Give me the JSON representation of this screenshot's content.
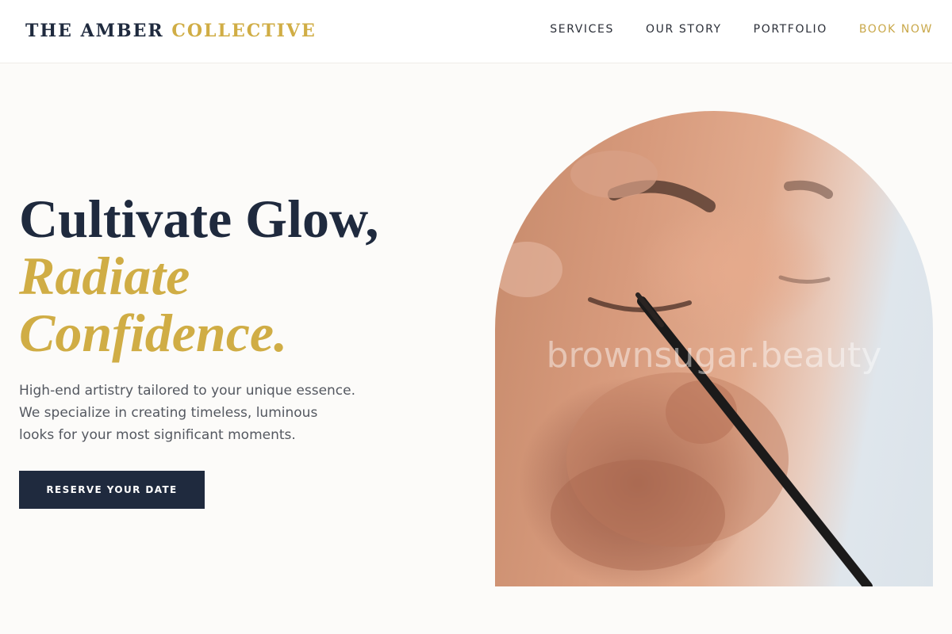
{
  "brand": {
    "part1": "THE AMBER",
    "part2": "COLLECTIVE"
  },
  "nav": {
    "items": [
      {
        "label": "SERVICES"
      },
      {
        "label": "OUR STORY"
      },
      {
        "label": "PORTFOLIO"
      }
    ],
    "cta": "BOOK NOW"
  },
  "hero": {
    "headline_line1": "Cultivate Glow,",
    "headline_line2": "Radiate",
    "headline_line3": "Confidence.",
    "description": "High-end artistry tailored to your unique essence.\nWe specialize in creating timeless, luminous\nlooks for your most significant moments.",
    "button_label": "RESERVE YOUR DATE",
    "image_watermark": "brownsugar.beauty"
  },
  "colors": {
    "navy": "#1f2a3e",
    "gold": "#d0ad45",
    "background": "#fcfbf9"
  }
}
